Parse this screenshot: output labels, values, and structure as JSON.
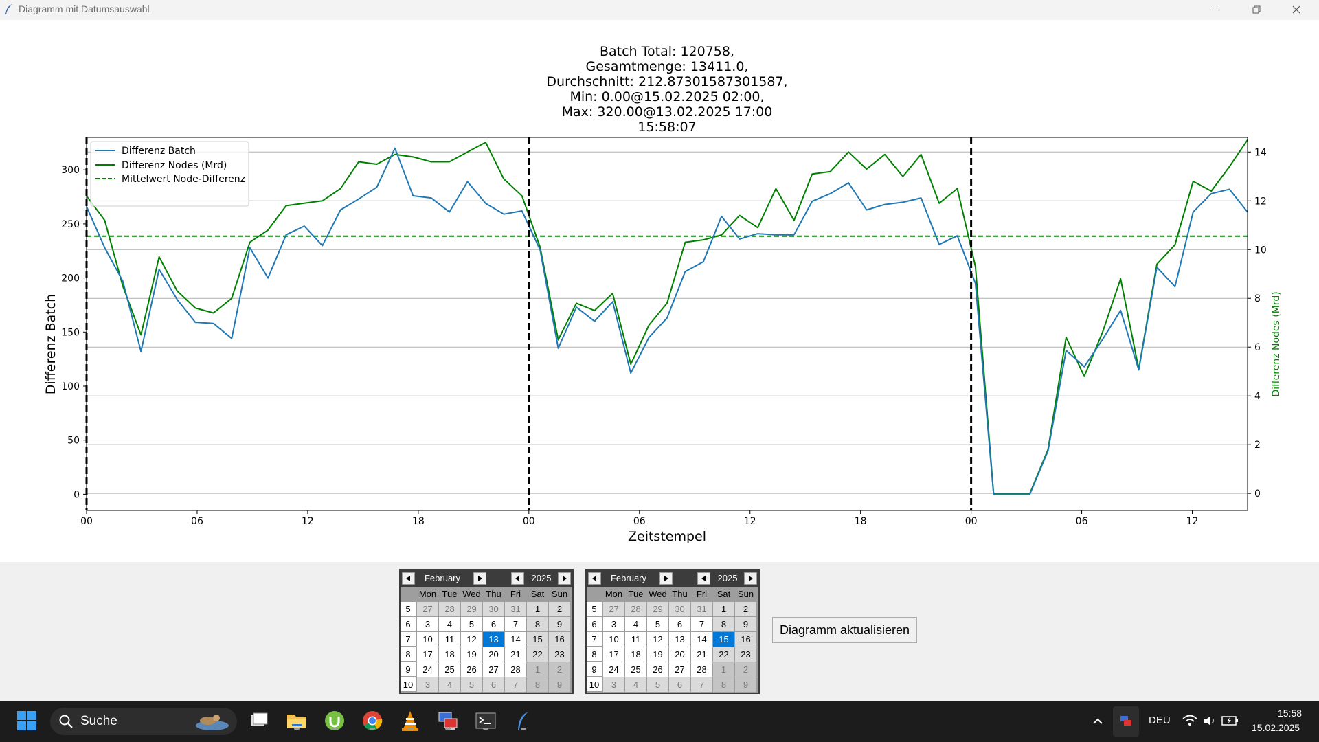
{
  "window": {
    "title": "Diagramm mit Datumsauswahl"
  },
  "chart_data": {
    "type": "line",
    "title_lines": [
      "Batch Total: 120758,",
      "Gesamtmenge: 13411.0,",
      "Durchschnitt: 212.87301587301587,",
      "Min: 0.00@15.02.2025 02:00,",
      "Max: 320.00@13.02.2025 17:00",
      "15:58:07"
    ],
    "xlabel": "Zeitstempel",
    "ylabel": "Differenz Batch",
    "y2label": "Differenz Nodes (Mrd)",
    "x_start": "2025-02-13 00:00",
    "x_end": "2025-02-15 15:00",
    "x_ticks": [
      "00",
      "06",
      "12",
      "18",
      "00",
      "06",
      "12",
      "18",
      "00",
      "06",
      "12"
    ],
    "ylim": [
      -15,
      330
    ],
    "y_ticks": [
      0,
      50,
      100,
      150,
      200,
      250,
      300
    ],
    "y2lim": [
      -0.7,
      14.6
    ],
    "y2_ticks": [
      0,
      2,
      4,
      6,
      8,
      10,
      12,
      14
    ],
    "day_separators": [
      "2025-02-14 00:00",
      "2025-02-15 00:00"
    ],
    "legend_position": "top-left",
    "grid": "horizontal",
    "legend": [
      "Differenz Batch",
      "Differenz Nodes (Mrd)",
      "Mittelwert Node-Differenz"
    ],
    "series": [
      {
        "name": "Differenz Batch",
        "axis": "left",
        "color": "#1f77b4",
        "values": [
          266,
          228,
          197,
          132,
          208,
          180,
          159,
          158,
          144,
          228,
          200,
          240,
          248,
          230,
          263,
          273,
          284,
          320,
          276,
          274,
          261,
          289,
          269,
          259,
          262,
          226,
          135,
          173,
          160,
          178,
          112,
          145,
          163,
          206,
          215,
          257,
          236,
          241,
          240,
          240,
          271,
          278,
          288,
          263,
          268,
          270,
          274,
          231,
          239,
          195,
          0,
          0,
          0,
          40,
          133,
          118,
          143,
          170,
          115,
          210,
          192,
          261,
          278,
          282,
          261
        ]
      },
      {
        "name": "Differenz Nodes (Mrd)",
        "axis": "right",
        "color": "#008000",
        "values": [
          12.2,
          11.2,
          8.5,
          6.5,
          9.7,
          8.3,
          7.6,
          7.4,
          8.0,
          10.3,
          10.8,
          11.8,
          11.9,
          12.0,
          12.5,
          13.6,
          13.5,
          13.9,
          13.8,
          13.6,
          13.6,
          14.0,
          14.4,
          12.9,
          12.2,
          10.1,
          6.3,
          7.8,
          7.5,
          8.2,
          5.3,
          6.9,
          7.8,
          10.3,
          10.4,
          10.6,
          11.4,
          10.9,
          12.5,
          11.2,
          13.1,
          13.2,
          14.0,
          13.3,
          13.9,
          13.0,
          13.9,
          11.9,
          12.5,
          9.3,
          0.0,
          0.0,
          0.0,
          1.8,
          6.4,
          4.8,
          6.6,
          8.8,
          5.1,
          9.4,
          10.2,
          12.8,
          12.4,
          13.4,
          14.5
        ]
      },
      {
        "name": "Mittelwert Node-Differenz",
        "axis": "right",
        "color": "#008000",
        "style": "dashed",
        "value": 10.55
      }
    ]
  },
  "calendar_start": {
    "month": "February",
    "year": "2025",
    "weekdays": [
      "Mon",
      "Tue",
      "Wed",
      "Thu",
      "Fri",
      "Sat",
      "Sun"
    ],
    "weeks": [
      {
        "no": "5",
        "days": [
          "27",
          "28",
          "29",
          "30",
          "31",
          "1",
          "2"
        ]
      },
      {
        "no": "6",
        "days": [
          "3",
          "4",
          "5",
          "6",
          "7",
          "8",
          "9"
        ]
      },
      {
        "no": "7",
        "days": [
          "10",
          "11",
          "12",
          "13",
          "14",
          "15",
          "16"
        ]
      },
      {
        "no": "8",
        "days": [
          "17",
          "18",
          "19",
          "20",
          "21",
          "22",
          "23"
        ]
      },
      {
        "no": "9",
        "days": [
          "24",
          "25",
          "26",
          "27",
          "28",
          "1",
          "2"
        ]
      },
      {
        "no": "10",
        "days": [
          "3",
          "4",
          "5",
          "6",
          "7",
          "8",
          "9"
        ]
      }
    ],
    "selected": "13"
  },
  "calendar_end": {
    "month": "February",
    "year": "2025",
    "weekdays": [
      "Mon",
      "Tue",
      "Wed",
      "Thu",
      "Fri",
      "Sat",
      "Sun"
    ],
    "weeks": [
      {
        "no": "5",
        "days": [
          "27",
          "28",
          "29",
          "30",
          "31",
          "1",
          "2"
        ]
      },
      {
        "no": "6",
        "days": [
          "3",
          "4",
          "5",
          "6",
          "7",
          "8",
          "9"
        ]
      },
      {
        "no": "7",
        "days": [
          "10",
          "11",
          "12",
          "13",
          "14",
          "15",
          "16"
        ]
      },
      {
        "no": "8",
        "days": [
          "17",
          "18",
          "19",
          "20",
          "21",
          "22",
          "23"
        ]
      },
      {
        "no": "9",
        "days": [
          "24",
          "25",
          "26",
          "27",
          "28",
          "1",
          "2"
        ]
      },
      {
        "no": "10",
        "days": [
          "3",
          "4",
          "5",
          "6",
          "7",
          "8",
          "9"
        ]
      }
    ],
    "selected": "15"
  },
  "update_button": {
    "label": "Diagramm aktualisieren"
  },
  "taskbar": {
    "search_label": "Suche",
    "apps": [
      "windows-start-icon",
      "task-view-icon",
      "file-explorer-icon",
      "utorrent-icon",
      "chrome-icon",
      "vlc-icon",
      "remote-desktop-icon",
      "terminal-icon",
      "feather-app-icon"
    ],
    "language": "DEU",
    "time": "15:58",
    "date": "15.02.2025"
  }
}
